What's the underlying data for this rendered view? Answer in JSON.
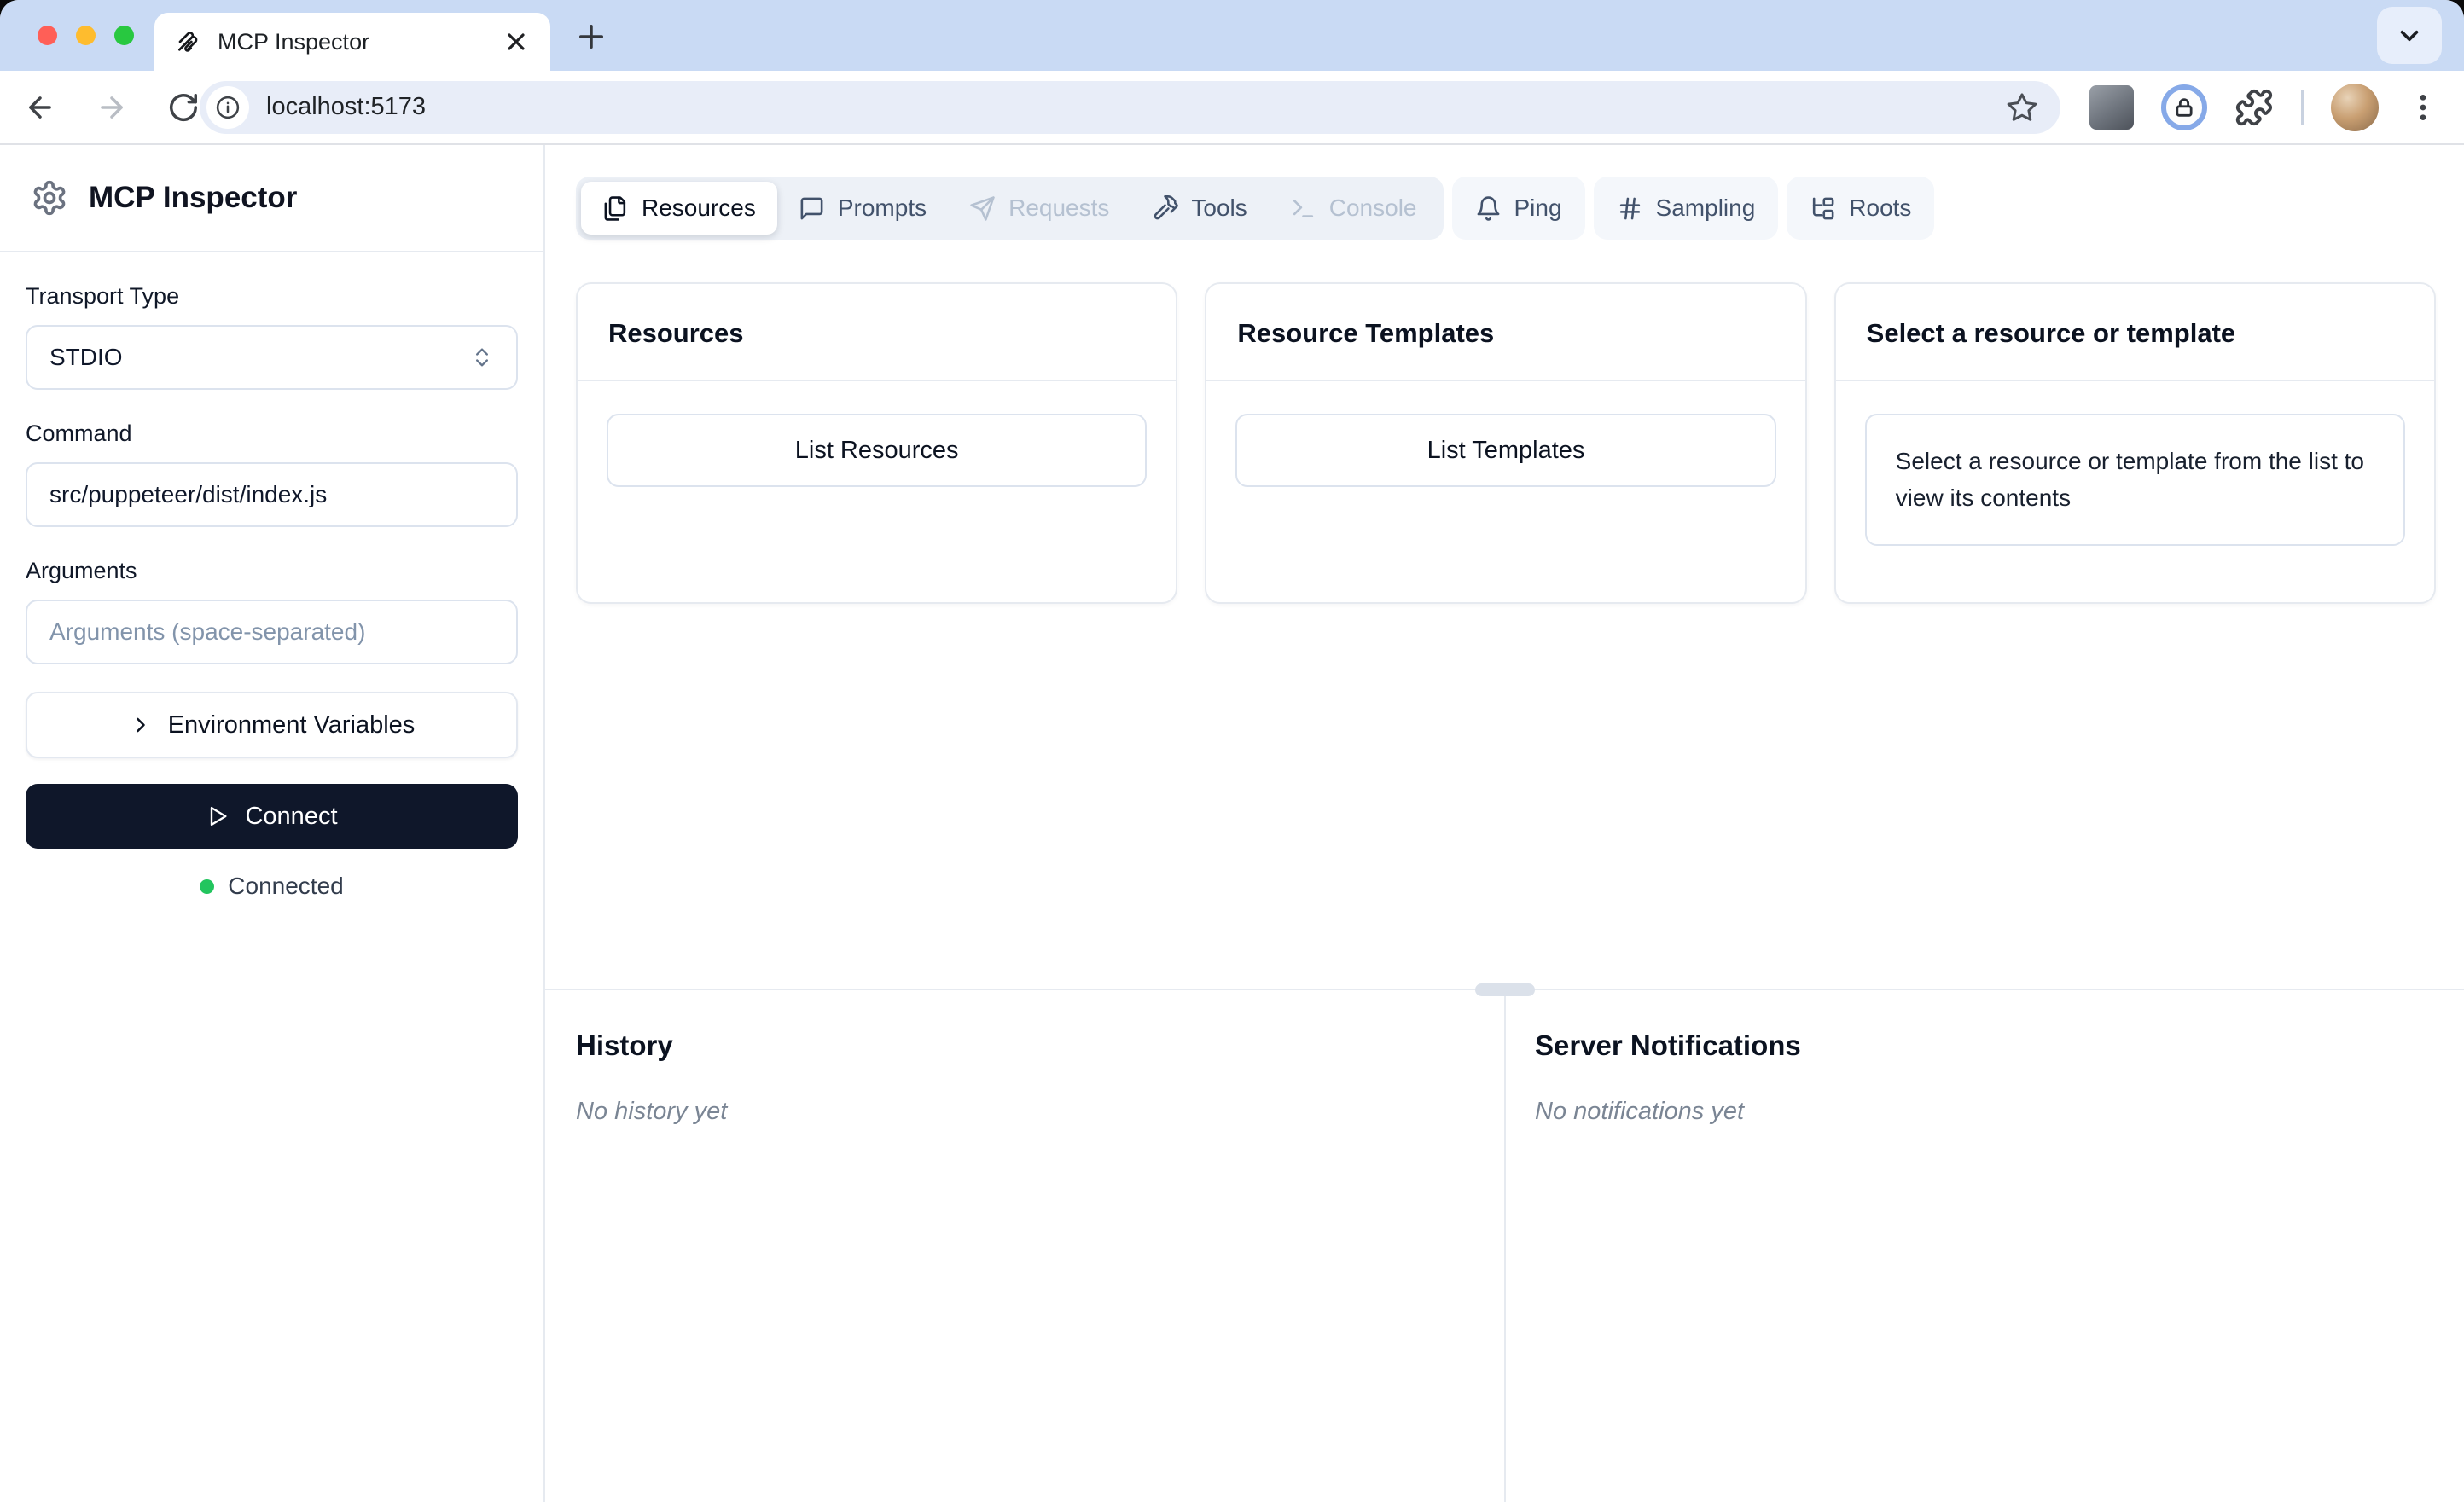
{
  "browser": {
    "tab_title": "MCP Inspector",
    "url": "localhost:5173"
  },
  "sidebar": {
    "title": "MCP Inspector",
    "transport_label": "Transport Type",
    "transport_value": "STDIO",
    "command_label": "Command",
    "command_value": "src/puppeteer/dist/index.js",
    "arguments_label": "Arguments",
    "arguments_placeholder": "Arguments (space-separated)",
    "env_variables_label": "Environment Variables",
    "connect_label": "Connect",
    "status_label": "Connected",
    "status_color": "#22c55e"
  },
  "tabs": [
    {
      "label": "Resources",
      "state": "active"
    },
    {
      "label": "Prompts",
      "state": "enabled"
    },
    {
      "label": "Requests",
      "state": "disabled"
    },
    {
      "label": "Tools",
      "state": "enabled"
    },
    {
      "label": "Console",
      "state": "disabled"
    },
    {
      "label": "Ping",
      "state": "enabled"
    },
    {
      "label": "Sampling",
      "state": "enabled"
    },
    {
      "label": "Roots",
      "state": "enabled"
    }
  ],
  "cards": {
    "resources": {
      "title": "Resources",
      "button": "List Resources"
    },
    "templates": {
      "title": "Resource Templates",
      "button": "List Templates"
    },
    "selection": {
      "title": "Select a resource or template",
      "body": "Select a resource or template from the list to view its contents"
    }
  },
  "panels": {
    "history": {
      "title": "History",
      "empty": "No history yet"
    },
    "notifications": {
      "title": "Server Notifications",
      "empty": "No notifications yet"
    }
  }
}
